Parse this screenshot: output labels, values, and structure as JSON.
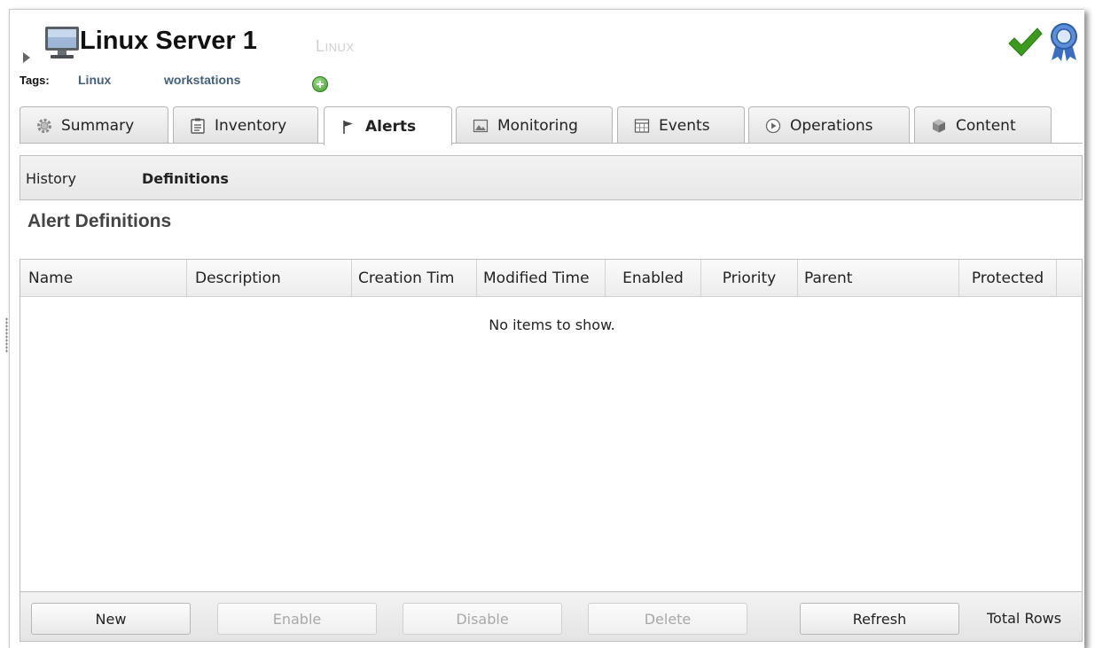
{
  "resource": {
    "title": "Linux Server 1",
    "type": "Linux",
    "tags_label": "Tags:",
    "tags": [
      "Linux",
      "workstations"
    ]
  },
  "colors": {
    "tag_link": "#45607a",
    "available": "#3b9a1e",
    "award": "#3a6fc4"
  },
  "icons": {
    "expand": "triangle-right",
    "resource": "monitor",
    "add_tag": "plus-circle",
    "availability": "checkmark",
    "award": "award-ribbon"
  },
  "tabs": [
    {
      "label": "Summary",
      "icon": "gear-icon"
    },
    {
      "label": "Inventory",
      "icon": "clipboard-icon"
    },
    {
      "label": "Alerts",
      "icon": "flag-icon",
      "selected": true
    },
    {
      "label": "Monitoring",
      "icon": "image-icon"
    },
    {
      "label": "Events",
      "icon": "calendar-grid-icon"
    },
    {
      "label": "Operations",
      "icon": "play-circle-icon"
    },
    {
      "label": "Content",
      "icon": "cube-icon"
    }
  ],
  "subtabs": [
    {
      "label": "History"
    },
    {
      "label": "Definitions",
      "selected": true
    }
  ],
  "section_title": "Alert Definitions",
  "grid": {
    "columns": [
      "Name",
      "Description",
      "Creation Tim",
      "Modified Time",
      "Enabled",
      "Priority",
      "Parent",
      "Protected"
    ],
    "empty_message": "No items to show."
  },
  "toolbar": {
    "new_label": "New",
    "enable_label": "Enable",
    "disable_label": "Disable",
    "delete_label": "Delete",
    "refresh_label": "Refresh",
    "total_rows_label": "Total Rows"
  }
}
